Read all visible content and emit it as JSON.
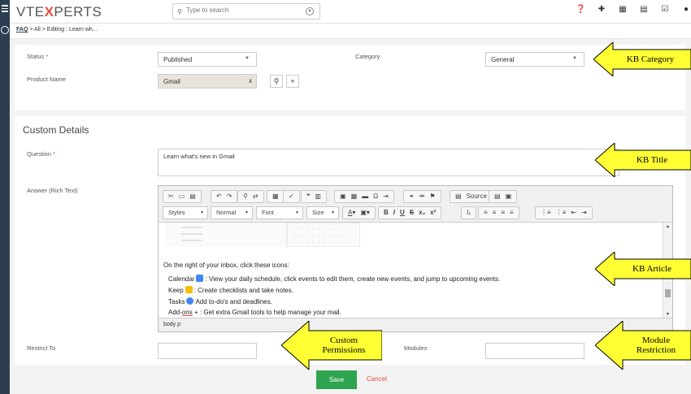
{
  "brand": {
    "logo_pre": "VTE",
    "logo_x": "X",
    "logo_post": "PERTS"
  },
  "search": {
    "placeholder": "Type to search"
  },
  "breadcrumb": {
    "module": "FAQ",
    "sep1": ">",
    "all": "All",
    "sep2": ">",
    "editing": "Editing : Learn wh..."
  },
  "header_icons": [
    "help-icon",
    "add-icon",
    "calendar-icon",
    "reports-icon",
    "tasks-icon",
    "user-icon"
  ],
  "main_form": {
    "status_label": "Status",
    "status_value": "Published",
    "category_label": "Category",
    "category_value": "General",
    "product_label": "Product Name",
    "product_value": "Gmail",
    "required_mark": "*"
  },
  "custom_details": {
    "title": "Custom Details",
    "question_label": "Question",
    "question_value": "Learn what's new in Gmail",
    "answer_label": "Answer (Rich Text)",
    "restrict_label": "Restrict To",
    "modules_label": "Modules"
  },
  "editor": {
    "source_label": "Source",
    "styles_label": "Styles",
    "normal_label": "Normal",
    "font_label": "Font",
    "size_label": "Size",
    "intro": "On the right of your inbox, click these icons:",
    "calendar_lead": "Calendar",
    "calendar_text": ": View your daily schedule, click events to edit them, create new events, and jump to upcoming events.",
    "keep_lead": "Keep",
    "keep_text": ": Create checklists and take notes.",
    "tasks_lead": "Tasks",
    "tasks_text": "Add to-do's and deadlines.",
    "addons_lead": "Add-",
    "addons_ul": "ons",
    "addons_plus": "+",
    "addons_text": ": Get extra Gmail tools to help manage your mail.",
    "path": "body  p"
  },
  "actions": {
    "save_label": "Save",
    "cancel_label": "Cancel"
  },
  "callouts": {
    "kb_category": "KB Category",
    "kb_title": "KB Title",
    "kb_article": "KB Article",
    "custom_permissions_1": "Custom",
    "custom_permissions_2": "Permissions",
    "module_restriction_1": "Module",
    "module_restriction_2": "Restriction"
  },
  "colors": {
    "callout_fill": "#ffff33",
    "save_green": "#2ea44f",
    "cancel_red": "#e74c3c",
    "sidebar": "#2c3e50"
  }
}
